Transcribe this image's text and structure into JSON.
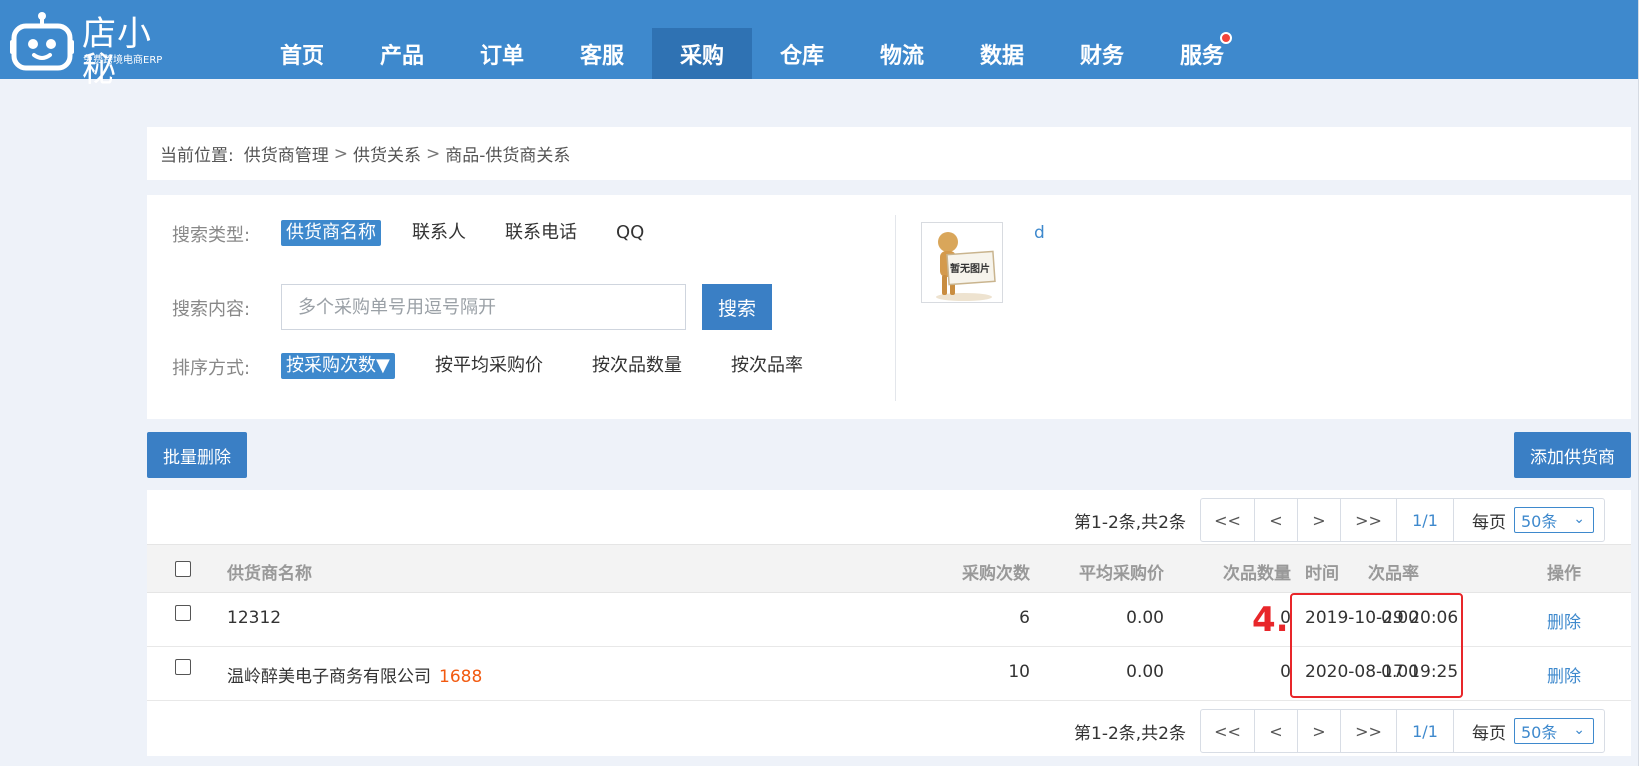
{
  "logo": {
    "title": "店小秘",
    "subtitle": "免费跨境电商ERP"
  },
  "nav": {
    "items": [
      "首页",
      "产品",
      "订单",
      "客服",
      "采购",
      "仓库",
      "物流",
      "数据",
      "财务",
      "服务"
    ],
    "active_index": 4
  },
  "breadcrumb": {
    "prefix": "当前位置:",
    "items": [
      "供货商管理",
      "供货关系",
      "商品-供货商关系"
    ],
    "separator": ">"
  },
  "search": {
    "type_label": "搜索类型:",
    "types": [
      "供货商名称",
      "联系人",
      "联系电话",
      "QQ"
    ],
    "content_label": "搜索内容:",
    "placeholder": "多个采购单号用逗号隔开",
    "button": "搜索",
    "sort_label": "排序方式:",
    "sorts": [
      "按采购次数▼",
      "按平均采购价",
      "按次品数量",
      "按次品率"
    ],
    "no_image_text": "暂无图片",
    "product_link": "d"
  },
  "actions": {
    "batch_delete": "批量删除",
    "add_supplier": "添加供货商"
  },
  "pager": {
    "info": "第1-2条,共2条",
    "first": "<<",
    "prev": "<",
    "next": ">",
    "last": ">>",
    "page": "1/1",
    "per_page_label": "每页",
    "per_page_value": "50条"
  },
  "table": {
    "headers": [
      "供货商名称",
      "采购次数",
      "平均采购价",
      "次品数量",
      "次品率",
      "时间",
      "操作"
    ],
    "rows": [
      {
        "name": "12312",
        "tag": "",
        "count": "6",
        "avg_price": "0.00",
        "defects": "0",
        "defect_rate": "0.00",
        "time": "2019-10-29 20:06",
        "action": "删除"
      },
      {
        "name": "温岭醉美电子商务有限公司",
        "tag": "1688",
        "count": "10",
        "avg_price": "0.00",
        "defects": "0",
        "defect_rate": "0.00",
        "time": "2020-08-17 19:25",
        "action": "删除"
      }
    ]
  },
  "annotation": {
    "label": "4.",
    "color": "#e8262a"
  },
  "colors": {
    "brand": "#3e89cd",
    "nav_active": "#2f72b3",
    "tag": "#f25a10"
  }
}
